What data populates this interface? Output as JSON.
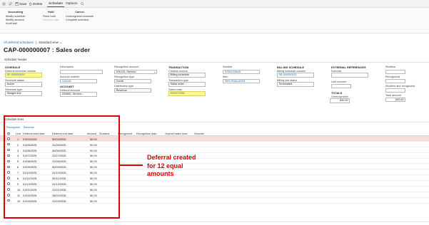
{
  "actionbar": {
    "save": "Save",
    "delete": "Delete",
    "tabs": [
      "Schedule",
      "Options"
    ]
  },
  "ribbon": {
    "groups": [
      {
        "title": "Accounting",
        "items": [
          "Modify schedule",
          "Modify account",
          "Audit trail"
        ]
      },
      {
        "title": "Hold",
        "items": [
          "Place hold",
          "Remove hold"
        ]
      },
      {
        "title": "Cancel",
        "items": [
          "Unrecognized amounts",
          "Complete schedule"
        ]
      }
    ]
  },
  "breadcrumb": {
    "link": "All deferral schedules",
    "separator": "|",
    "view": "Standard view"
  },
  "page_title": "CAP-000000007 : Sales order",
  "header_section": "Schedule header",
  "header": {
    "schedule": {
      "title": "SCHEDULE",
      "deferral_schedule_number_label": "Deferral schedule number",
      "deferral_schedule_number": "DF-000000007",
      "schedule_status_label": "Schedule status",
      "schedule_status": "Active",
      "schedule_type_label": "Schedule type",
      "schedule_type": "Straight line"
    },
    "desc": {
      "description_label": "Description",
      "description": "",
      "account_number_label": "Account number",
      "account_number": "C00116",
      "account_title": "ACCOUNT",
      "deferral_account_label": "Deferral account",
      "deferral_account": "250600--Service--"
    },
    "recognition": {
      "recognition_account_label": "Recognition account",
      "recognition_account": "401100--Service--",
      "recognition_type_label": "Recognition type",
      "recognition_type": "Credit",
      "distribution_type_label": "Distribution type",
      "distribution_type": "Revenue"
    },
    "transaction": {
      "title": "TRANSACTION",
      "creation_source_label": "Creation source",
      "creation_source": "Billing schedule",
      "transaction_type_label": "Transaction type",
      "transaction_type": "Sales order",
      "sales_order_label": "Sales order",
      "sales_order": "SO0017650"
    },
    "number": {
      "number_label": "Number",
      "number": "SSN1028845",
      "item_label": "Item",
      "item": "SBS-RNW-ANN1"
    },
    "billing": {
      "title": "BILLING SCHEDULE",
      "billing_schedule_number_label": "Billing schedule number",
      "billing_schedule_number": "SB-000000021",
      "billing_line_status_label": "Billing line status",
      "billing_line_status": "Terminated"
    },
    "external": {
      "title": "EXTERNAL REFERENCES",
      "external_label": "External",
      "external": "",
      "line_number_label": "Line number",
      "line_number": "",
      "totals_title": "TOTALS",
      "unrecognized_label": "Unrecognized",
      "unrecognized": "600.00"
    },
    "amounts": {
      "stubbed_label": "Stubbed",
      "stubbed": "",
      "recognized_label": "Recognized",
      "recognized": "",
      "stubbed_and_recognized_label": "Stubbed and recognized",
      "stubbed_and_recognized": "",
      "total_amount_label": "Total amount",
      "total_amount": "600.00"
    }
  },
  "lines_section": "Schedule lines",
  "lines_actions": [
    "Recognize",
    "Reverse"
  ],
  "grid": {
    "columns": [
      "Line",
      "Deferral start date",
      "Deferral end date",
      "Amount",
      "Stubbed",
      "Recognized",
      "Recognition date",
      "Journal batch num...",
      "Voucher"
    ],
    "rows": [
      {
        "line": "1",
        "start": "01/04/2025",
        "end": "30/04/2025",
        "amount": "50.00"
      },
      {
        "line": "2",
        "start": "01/05/2025",
        "end": "31/05/2025",
        "amount": "50.00"
      },
      {
        "line": "3",
        "start": "01/06/2025",
        "end": "30/06/2025",
        "amount": "50.00"
      },
      {
        "line": "4",
        "start": "01/07/2025",
        "end": "31/07/2025",
        "amount": "50.00"
      },
      {
        "line": "5",
        "start": "01/08/2025",
        "end": "31/08/2025",
        "amount": "50.00"
      },
      {
        "line": "6",
        "start": "01/09/2025",
        "end": "30/09/2025",
        "amount": "50.00"
      },
      {
        "line": "7",
        "start": "01/10/2025",
        "end": "31/10/2025",
        "amount": "50.00"
      },
      {
        "line": "8",
        "start": "01/11/2025",
        "end": "30/11/2025",
        "amount": "50.00"
      },
      {
        "line": "9",
        "start": "01/12/2025",
        "end": "31/12/2025",
        "amount": "50.00"
      },
      {
        "line": "10",
        "start": "01/01/2026",
        "end": "31/01/2026",
        "amount": "50.00"
      },
      {
        "line": "11",
        "start": "01/02/2026",
        "end": "28/02/2026",
        "amount": "50.00"
      },
      {
        "line": "12",
        "start": "01/03/2026",
        "end": "31/03/2026",
        "amount": "50.00"
      }
    ]
  },
  "annotation": {
    "line1": "Deferral created",
    "line2": "for 12 equal",
    "line3": "amounts"
  },
  "colors": {
    "accent": "#0f6cbd",
    "annotation": "#e00000",
    "highlight": "#fffa8a",
    "selected_row": "#f9dada"
  }
}
